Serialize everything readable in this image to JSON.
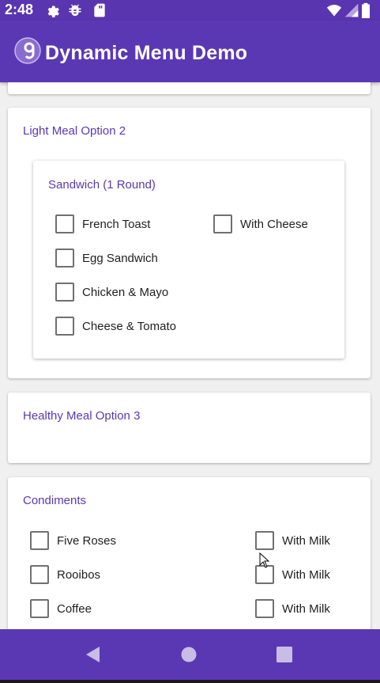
{
  "statusbar": {
    "time": "2:48"
  },
  "app": {
    "title": "Dynamic Menu Demo"
  },
  "cards": {
    "light": {
      "title": "Light Meal Option 2",
      "group": {
        "title": "Sandwich (1 Round)",
        "options": [
          "French Toast",
          "Egg Sandwich",
          "Chicken & Mayo",
          "Cheese & Tomato"
        ],
        "extra": "With Cheese"
      }
    },
    "healthy": {
      "title": "Healthy Meal Option 3"
    },
    "condiments": {
      "title": "Condiments",
      "items": [
        "Five Roses",
        "Rooibos",
        "Coffee"
      ],
      "extras": [
        "With Milk",
        "With Milk",
        "With Milk"
      ]
    }
  },
  "colors": {
    "primary": "#5b38b3",
    "checkbox_border": "#707070"
  },
  "icons": [
    "gear-icon",
    "bug-icon",
    "sd-card-icon",
    "wifi-icon",
    "signal-icon",
    "battery-icon",
    "app-logo-icon",
    "back-icon",
    "home-icon",
    "recents-icon"
  ]
}
